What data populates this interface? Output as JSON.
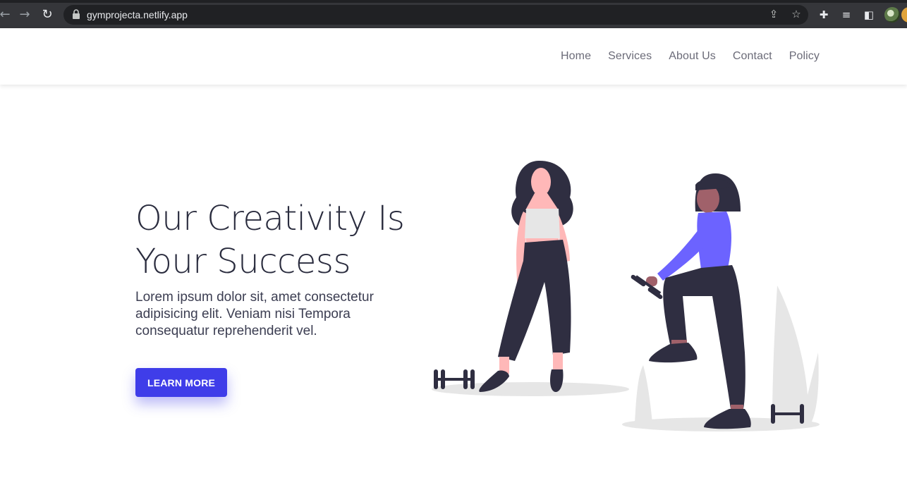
{
  "browser": {
    "url": "gymprojecta.netlify.app",
    "icons": [
      "back-icon",
      "forward-icon",
      "reload-icon",
      "lock-icon",
      "share-icon",
      "bookmark-star-icon",
      "extensions-icon",
      "reading-list-icon",
      "side-panel-icon",
      "profile-avatar"
    ]
  },
  "nav": {
    "items": [
      "Home",
      "Services",
      "About Us",
      "Contact",
      "Policy"
    ]
  },
  "hero": {
    "title_line1": "Our Creativity Is",
    "title_line2": "Your Success",
    "text": "Lorem ipsum dolor sit, amet consectetur adipisicing elit. Veniam nisi Tempora consequatur reprehenderit vel.",
    "button_label": "LEARN MORE"
  },
  "colors": {
    "accent": "#3f3de9",
    "heading": "#2a2c3e",
    "nav_text": "#6b6b78"
  }
}
